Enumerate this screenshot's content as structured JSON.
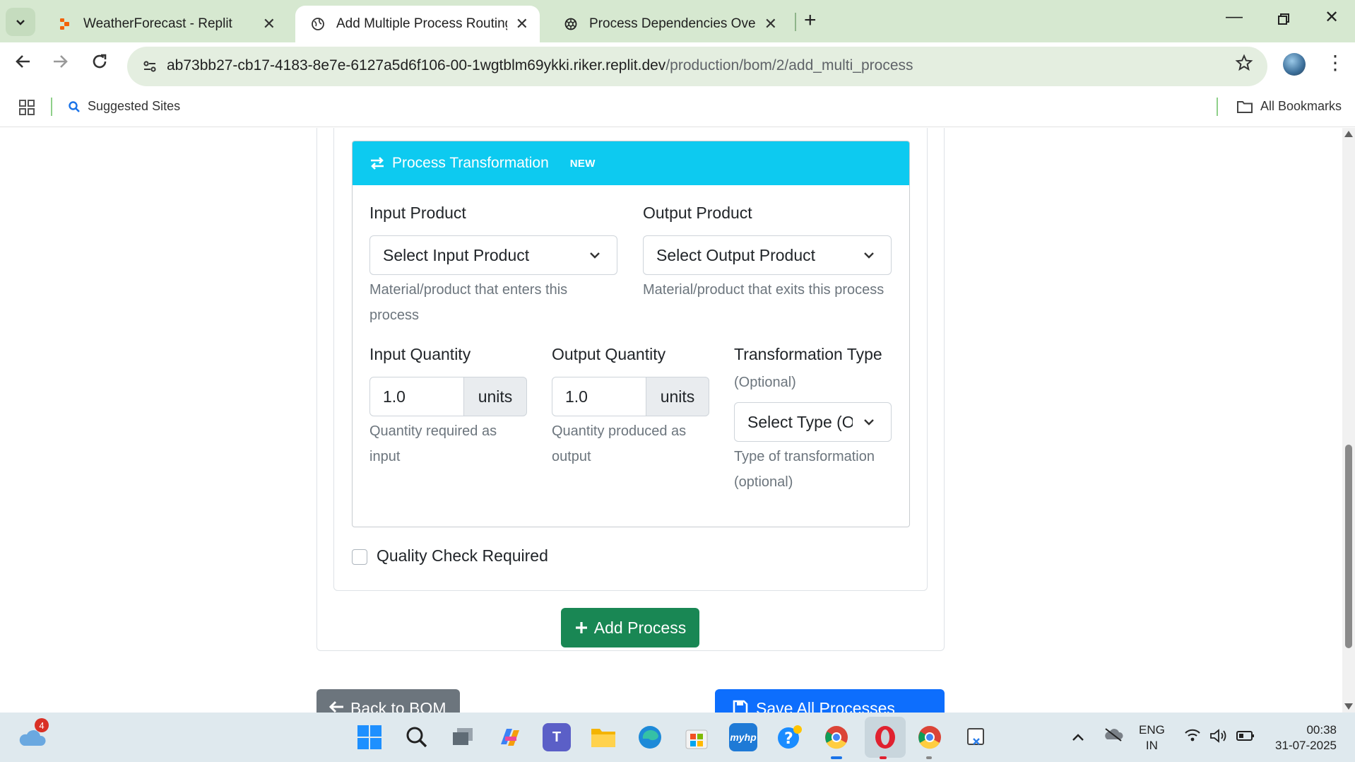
{
  "browser": {
    "tabs": [
      {
        "title": "WeatherForecast - Replit",
        "active": false
      },
      {
        "title": "Add Multiple Process Routing -",
        "active": true
      },
      {
        "title": "Process Dependencies Overview",
        "active": false
      }
    ],
    "url_host": "ab73bb27-cb17-4183-8e7e-6127a5d6f106-00-1wgtblm69ykki.riker.replit.dev",
    "url_path": "/production/bom/2/add_multi_process",
    "bookmarks": {
      "suggested": "Suggested Sites",
      "all": "All Bookmarks"
    }
  },
  "page": {
    "transformation": {
      "header": "Process Transformation",
      "badge": "NEW",
      "input_product": {
        "label": "Input Product",
        "selected": "Select Input Product",
        "help": "Material/product that enters this process"
      },
      "output_product": {
        "label": "Output Product",
        "selected": "Select Output Product",
        "help": "Material/product that exits this process"
      },
      "input_quantity": {
        "label": "Input Quantity",
        "value": "1.0",
        "unit": "units",
        "help": "Quantity required as input"
      },
      "output_quantity": {
        "label": "Output Quantity",
        "value": "1.0",
        "unit": "units",
        "help": "Quantity produced as output"
      },
      "transformation_type": {
        "label": "Transformation Type",
        "label_suffix": "(Optional)",
        "selected": "Select Type (Optional)",
        "help": "Type of transformation (optional)"
      }
    },
    "quality_check": {
      "label": "Quality Check Required",
      "checked": false
    },
    "add_process_button": "Add Process",
    "back_button": "Back to BOM",
    "save_button": "Save All Processes"
  },
  "taskbar": {
    "weather_badge": "4",
    "lang_line1": "ENG",
    "lang_line2": "IN",
    "time": "00:38",
    "date": "31-07-2025"
  },
  "colors": {
    "info_header": "#0dcaf0",
    "success": "#198754",
    "primary": "#0d6efd",
    "secondary": "#6c757d",
    "chrome_frame": "#d6e8d0"
  }
}
